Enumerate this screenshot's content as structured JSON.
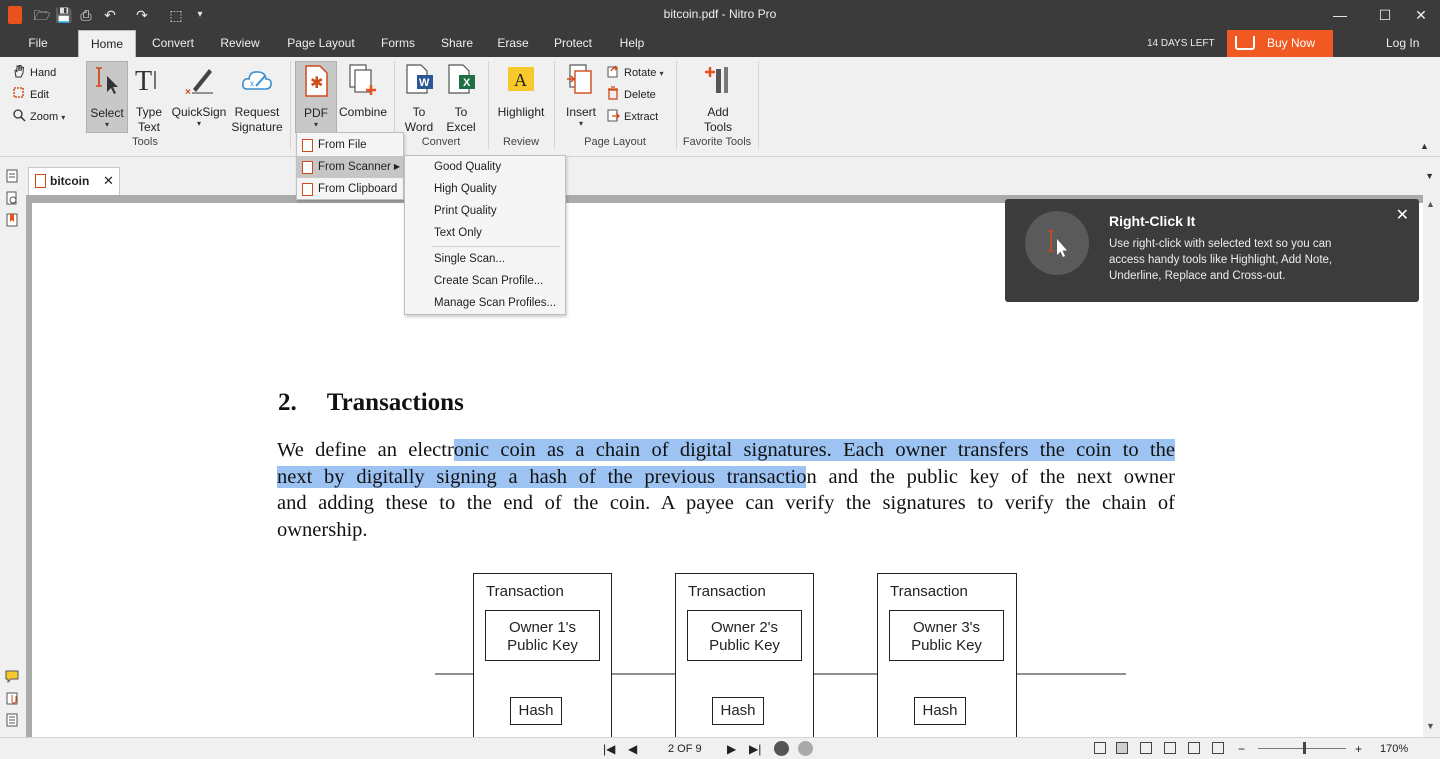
{
  "window": {
    "title": "bitcoin.pdf - Nitro Pro",
    "minimize": "—",
    "maximize": "☐",
    "close": "✕"
  },
  "quick_access": {
    "open": "🗁",
    "save": "💾",
    "print": "⎙",
    "undo": "↶",
    "redo": "↷",
    "select_tool": "⬚",
    "customize": "▾"
  },
  "menu": {
    "tabs": [
      "File",
      "Home",
      "Convert",
      "Review",
      "Page Layout",
      "Forms",
      "Share",
      "Erase",
      "Protect",
      "Help"
    ],
    "active": "Home",
    "trial": "14 DAYS LEFT",
    "buy": "Buy Now",
    "login": "Log In"
  },
  "ribbon": {
    "tools": {
      "hand": "Hand",
      "edit": "Edit",
      "zoom": "Zoom",
      "zoom_arrow": "▾",
      "select": "Select",
      "type_text": "Type Text",
      "quicksign": "QuickSign",
      "request_signature": "Request Signature",
      "label": "Tools"
    },
    "convert": {
      "pdf": "PDF",
      "combine": "Combine",
      "to_word": "To Word",
      "to_excel": "To Excel",
      "label": "Convert"
    },
    "review": {
      "highlight": "Highlight",
      "label": "Review"
    },
    "page_layout": {
      "insert": "Insert",
      "rotate": "Rotate",
      "delete": "Delete",
      "extract": "Extract",
      "label": "Page Layout"
    },
    "favorite": {
      "add_tools": "Add Tools",
      "label": "Favorite Tools"
    },
    "arrow": "▾"
  },
  "pdf_menu": {
    "items": [
      "From File",
      "From Scanner",
      "From Clipboard"
    ],
    "submenu_arrow": "▶"
  },
  "scanner_menu": {
    "items": [
      "Good Quality",
      "High Quality",
      "Print Quality",
      "Text Only",
      "Single Scan...",
      "Create Scan Profile...",
      "Manage Scan Profiles..."
    ]
  },
  "doc_tab": {
    "name": "bitcoin",
    "close": "✕",
    "overflow": "▼"
  },
  "tip": {
    "title": "Right-Click It",
    "body": "Use right-click with selected text so you can access handy tools like Highlight, Add Note, Underline, Replace and Cross-out.",
    "close": "✕"
  },
  "document": {
    "section_number": "2.",
    "section_title": "Transactions",
    "lines": [
      {
        "pre": "We define an electr",
        "hl": "onic coin as a chain of digital signatures.  Each owner transfers the coin to the",
        "post": ""
      },
      {
        "pre": "",
        "hl": "next by digitally signing a hash of the previous transactio",
        "post": "n and the public key of the next owner"
      },
      {
        "pre": "and adding these to the end of the coin.  A payee can verify the signatures to verify the chain of",
        "hl": "",
        "post": ""
      },
      {
        "pre": "ownership.",
        "hl": "",
        "post": ""
      }
    ],
    "diagram": {
      "transactions": [
        {
          "label": "Transaction",
          "key_line1": "Owner 1's",
          "key_line2": "Public Key",
          "hash": "Hash"
        },
        {
          "label": "Transaction",
          "key_line1": "Owner 2's",
          "key_line2": "Public Key",
          "hash": "Hash"
        },
        {
          "label": "Transaction",
          "key_line1": "Owner 3's",
          "key_line2": "Public Key",
          "hash": "Hash"
        }
      ]
    }
  },
  "status": {
    "page": "2 OF 9",
    "zoom": "170%",
    "zoom_minus": "−",
    "zoom_plus": "+",
    "first": "|◀",
    "prev": "◀",
    "next": "▶",
    "last": "▶|"
  },
  "colors": {
    "accent": "#f05a22",
    "dark": "#3b3b3b",
    "highlight": "#9cc3f2"
  }
}
